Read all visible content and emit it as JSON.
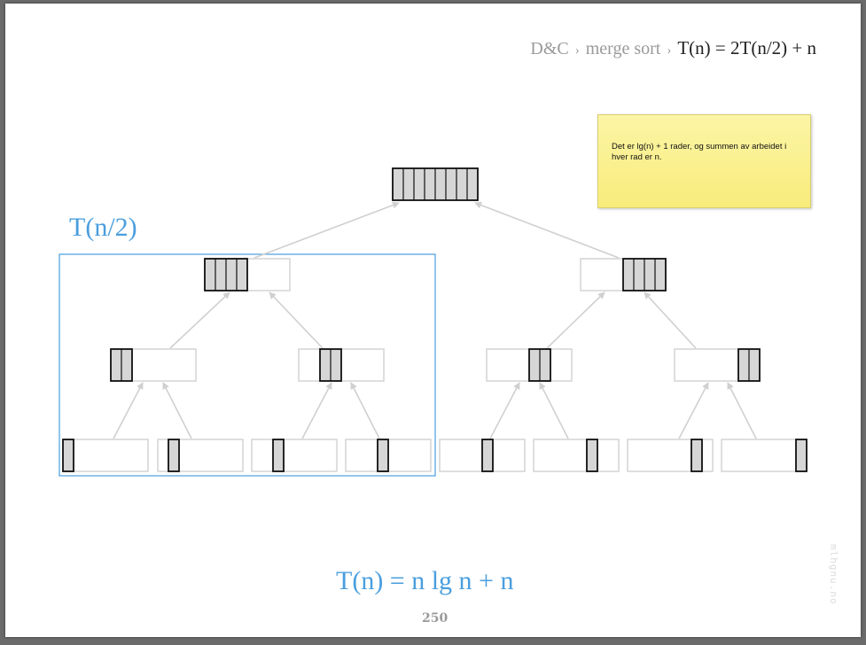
{
  "breadcrumb": {
    "items": [
      "D&C",
      "merge sort"
    ],
    "separator": "›",
    "current": "T(n) = 2T(n/2) + n"
  },
  "note": {
    "text": "Det er lg(n) + 1 rader, og summen av arbeidet i hver rad er n."
  },
  "subproblem_label": "T(n/2)",
  "formula": "T(n) = n lg n + n",
  "page_number": "250",
  "watermark": "mlhgnu.no",
  "colors": {
    "accent_blue": "#4a9ede",
    "cell_fill": "#d6d6d6",
    "cell_border": "#111111",
    "empty_border": "#cfcfcf",
    "arrow": "#d0d0d0",
    "note_bg": "#f8ec7b"
  },
  "tree": {
    "levels": [
      {
        "level": 0,
        "nodes": [
          {
            "filled_cells": 8,
            "side": "full"
          }
        ]
      },
      {
        "level": 1,
        "nodes": [
          {
            "filled_cells": 4,
            "side": "left"
          },
          {
            "filled_cells": 4,
            "side": "right"
          }
        ]
      },
      {
        "level": 2,
        "nodes": [
          {
            "filled_cells": 2,
            "side": "left"
          },
          {
            "filled_cells": 2,
            "side": "right"
          },
          {
            "filled_cells": 2,
            "side": "right"
          },
          {
            "filled_cells": 2,
            "side": "right"
          }
        ]
      },
      {
        "level": 3,
        "nodes": [
          {
            "filled_cells": 1,
            "side": "left"
          },
          {
            "filled_cells": 1,
            "side": "right"
          },
          {
            "filled_cells": 1,
            "side": "left"
          },
          {
            "filled_cells": 1,
            "side": "right"
          },
          {
            "filled_cells": 1,
            "side": "right"
          },
          {
            "filled_cells": 1,
            "side": "right"
          },
          {
            "filled_cells": 1,
            "side": "right"
          },
          {
            "filled_cells": 1,
            "side": "right"
          }
        ]
      }
    ]
  }
}
